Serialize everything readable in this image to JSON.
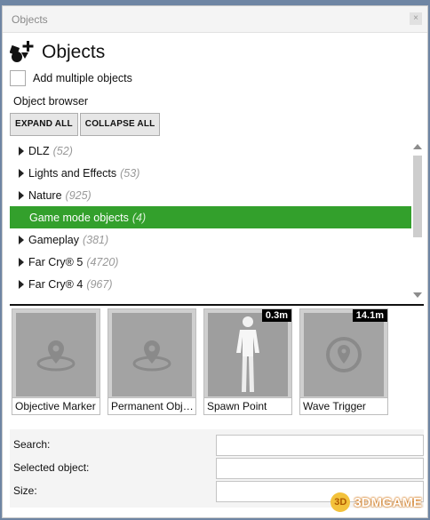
{
  "window": {
    "title": "Objects",
    "close_symbol": "×"
  },
  "header": {
    "title": "Objects"
  },
  "options": {
    "add_multiple_label": "Add multiple objects",
    "add_multiple_checked": false
  },
  "browser": {
    "label": "Object browser",
    "expand_all": "EXPAND ALL",
    "collapse_all": "COLLAPSE ALL"
  },
  "tree": [
    {
      "label": "DLZ",
      "count": "(52)",
      "selected": false
    },
    {
      "label": "Lights and Effects",
      "count": "(53)",
      "selected": false
    },
    {
      "label": "Nature",
      "count": "(925)",
      "selected": false
    },
    {
      "label": "Game mode objects",
      "count": "(4)",
      "selected": true
    },
    {
      "label": "Gameplay",
      "count": "(381)",
      "selected": false
    },
    {
      "label": "Far Cry® 5",
      "count": "(4720)",
      "selected": false
    },
    {
      "label": "Far Cry® 4",
      "count": "(967)",
      "selected": false
    }
  ],
  "thumbnails": [
    {
      "caption": "Objective Marker",
      "distance": "",
      "icon": "location-pin-icon"
    },
    {
      "caption": "Permanent Obje…",
      "distance": "",
      "icon": "location-pin-icon"
    },
    {
      "caption": "Spawn Point",
      "distance": "0.3m",
      "icon": "person-figure"
    },
    {
      "caption": "Wave Trigger",
      "distance": "14.1m",
      "icon": "target-pin-icon"
    }
  ],
  "properties": {
    "search_label": "Search:",
    "selected_label": "Selected object:",
    "size_label": "Size:"
  },
  "watermark": {
    "text": "3DMGAME",
    "badge": "3D"
  },
  "colors": {
    "selected_green": "#33a02c"
  }
}
